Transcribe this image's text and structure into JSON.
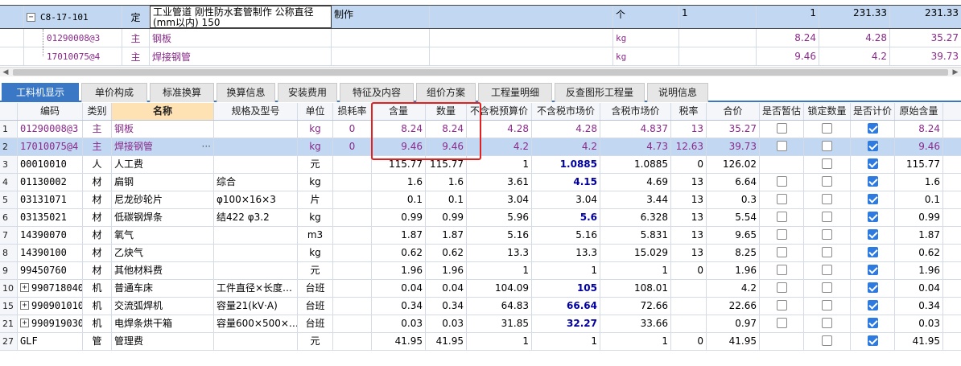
{
  "top_table": {
    "main_row": {
      "expand": "−",
      "code": "C8-17-101",
      "type": "定",
      "name": "工业管道 刚性防水套管制作 公称直径(mm以内) 150",
      "work": "制作",
      "unit": "个",
      "col_a": "1",
      "quantity": "1",
      "price": "231.33",
      "total": "231.33"
    },
    "sub_rows": [
      {
        "code": "01290008@3",
        "type": "主",
        "name": "钢板",
        "unit": "kg",
        "qty": "8.24",
        "price": "4.28",
        "total": "35.27"
      },
      {
        "code": "17010075@4",
        "type": "主",
        "name": "焊接钢管",
        "unit": "kg",
        "qty": "9.46",
        "price": "4.2",
        "total": "39.73"
      }
    ]
  },
  "scrollbar": {
    "left_arrow": "◀",
    "right_arrow": "▶"
  },
  "tabs": [
    "工料机显示",
    "单价构成",
    "标准换算",
    "换算信息",
    "安装费用",
    "特征及内容",
    "组价方案",
    "工程量明细",
    "反查图形工程量",
    "说明信息"
  ],
  "grid": {
    "headers": [
      "",
      "编码",
      "类别",
      "名称",
      "规格及型号",
      "单位",
      "损耗率",
      "含量",
      "数量",
      "不含税预算价",
      "不含税市场价",
      "含税市场价",
      "税率",
      "合价",
      "是否暂估",
      "锁定数量",
      "是否计价",
      "原始含量"
    ],
    "rows": [
      {
        "idx": "1",
        "code": "01290008@3",
        "cat": "主",
        "name": "钢板",
        "spec": "",
        "unit": "kg",
        "loss": "0",
        "content": "8.24",
        "qty": "8.24",
        "budget": "4.28",
        "market": "4.28",
        "tax_market": "4.837",
        "tax": "13",
        "total": "35.27",
        "est": false,
        "lock": false,
        "price": true,
        "orig": "8.24",
        "purple": true
      },
      {
        "idx": "2",
        "code": "17010075@4",
        "cat": "主",
        "name": "焊接钢管",
        "spec": "",
        "unit": "kg",
        "loss": "0",
        "content": "9.46",
        "qty": "9.46",
        "budget": "4.2",
        "market": "4.2",
        "tax_market": "4.73",
        "tax": "12.63",
        "total": "39.73",
        "est": false,
        "lock": false,
        "price": true,
        "orig": "9.46",
        "purple": true,
        "selected": true,
        "dots": "···"
      },
      {
        "idx": "3",
        "code": "00010010",
        "cat": "人",
        "name": "人工费",
        "spec": "",
        "unit": "元",
        "loss": "",
        "content": "115.77",
        "qty": "115.77",
        "budget": "1",
        "market": "1.0885",
        "market_bold": true,
        "tax_market": "1.0885",
        "tax": "0",
        "total": "126.02",
        "est": null,
        "lock": false,
        "price": true,
        "orig": "115.77"
      },
      {
        "idx": "4",
        "code": "01130002",
        "cat": "材",
        "name": "扁钢",
        "spec": "综合",
        "unit": "kg",
        "loss": "",
        "content": "1.6",
        "qty": "1.6",
        "budget": "3.61",
        "market": "4.15",
        "market_bold": true,
        "tax_market": "4.69",
        "tax": "13",
        "total": "6.64",
        "est": false,
        "lock": false,
        "price": true,
        "orig": "1.6"
      },
      {
        "idx": "5",
        "code": "03131071",
        "cat": "材",
        "name": "尼龙砂轮片",
        "spec": "φ100×16×3",
        "unit": "片",
        "loss": "",
        "content": "0.1",
        "qty": "0.1",
        "budget": "3.04",
        "market": "3.04",
        "tax_market": "3.44",
        "tax": "13",
        "total": "0.3",
        "est": false,
        "lock": false,
        "price": true,
        "orig": "0.1"
      },
      {
        "idx": "6",
        "code": "03135021",
        "cat": "材",
        "name": "低碳钢焊条",
        "spec": "结422 φ3.2",
        "unit": "kg",
        "loss": "",
        "content": "0.99",
        "qty": "0.99",
        "budget": "5.96",
        "market": "5.6",
        "market_bold": true,
        "tax_market": "6.328",
        "tax": "13",
        "total": "5.54",
        "est": false,
        "lock": false,
        "price": true,
        "orig": "0.99"
      },
      {
        "idx": "7",
        "code": "14390070",
        "cat": "材",
        "name": "氧气",
        "spec": "",
        "unit": "m3",
        "loss": "",
        "content": "1.87",
        "qty": "1.87",
        "budget": "5.16",
        "market": "5.16",
        "tax_market": "5.831",
        "tax": "13",
        "total": "9.65",
        "est": false,
        "lock": false,
        "price": true,
        "orig": "1.87"
      },
      {
        "idx": "8",
        "code": "14390100",
        "cat": "材",
        "name": "乙炔气",
        "spec": "",
        "unit": "kg",
        "loss": "",
        "content": "0.62",
        "qty": "0.62",
        "budget": "13.3",
        "market": "13.3",
        "tax_market": "15.029",
        "tax": "13",
        "total": "8.25",
        "est": false,
        "lock": false,
        "price": true,
        "orig": "0.62"
      },
      {
        "idx": "9",
        "code": "99450760",
        "cat": "材",
        "name": "其他材料费",
        "spec": "",
        "unit": "元",
        "loss": "",
        "content": "1.96",
        "qty": "1.96",
        "budget": "1",
        "market": "1",
        "tax_market": "1",
        "tax": "0",
        "total": "1.96",
        "est": false,
        "lock": false,
        "price": true,
        "orig": "1.96"
      },
      {
        "idx": "10",
        "code": "990718040",
        "cat": "机",
        "name": "普通车床",
        "spec": "工件直径×长度…",
        "unit": "台班",
        "loss": "",
        "content": "0.04",
        "qty": "0.04",
        "budget": "104.09",
        "market": "105",
        "market_bold": true,
        "tax_market": "108.01",
        "tax": "",
        "total": "4.2",
        "est": false,
        "lock": false,
        "price": true,
        "orig": "0.04",
        "plus": true
      },
      {
        "idx": "15",
        "code": "990901010",
        "cat": "机",
        "name": "交流弧焊机",
        "spec": "容量21(kV·A)",
        "unit": "台班",
        "loss": "",
        "content": "0.34",
        "qty": "0.34",
        "budget": "64.83",
        "market": "66.64",
        "market_bold": true,
        "tax_market": "72.66",
        "tax": "",
        "total": "22.66",
        "est": false,
        "lock": false,
        "price": true,
        "orig": "0.34",
        "plus": true
      },
      {
        "idx": "21",
        "code": "990919030",
        "cat": "机",
        "name": "电焊条烘干箱",
        "spec": "容量600×500×…",
        "unit": "台班",
        "loss": "",
        "content": "0.03",
        "qty": "0.03",
        "budget": "31.85",
        "market": "32.27",
        "market_bold": true,
        "tax_market": "33.66",
        "tax": "",
        "total": "0.97",
        "est": false,
        "lock": false,
        "price": true,
        "orig": "0.03",
        "plus": true
      },
      {
        "idx": "27",
        "code": "GLF",
        "cat": "管",
        "name": "管理费",
        "spec": "",
        "unit": "元",
        "loss": "",
        "content": "41.95",
        "qty": "41.95",
        "budget": "1",
        "market": "1",
        "tax_market": "1",
        "tax": "0",
        "total": "41.95",
        "est": null,
        "lock": false,
        "price": true,
        "orig": "41.95"
      }
    ]
  },
  "colors": {
    "selected_row": "#c2d8f2",
    "tab_active": "#3a78c5",
    "name_header": "#ffe2b3",
    "highlight_box": "#e32020",
    "main_material_text": "#8a2a8a"
  }
}
